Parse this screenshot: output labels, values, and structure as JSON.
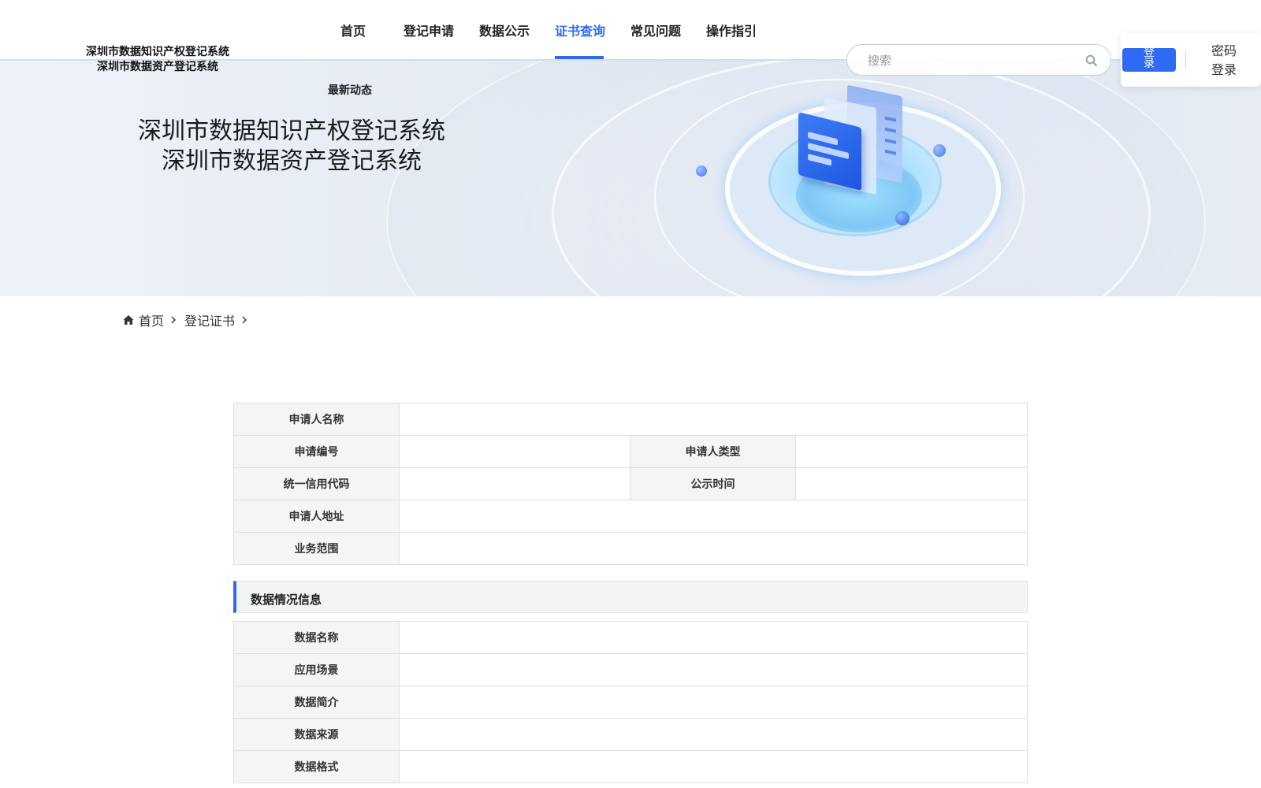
{
  "app": {
    "logo_line1": "深圳市数据知识产权登记系统",
    "logo_line2": "深圳市数据资产登记系统"
  },
  "nav": {
    "items": [
      {
        "label": "首页",
        "active": false
      },
      {
        "label": "登记申请",
        "active": false
      },
      {
        "label": "数据公示",
        "active": false
      },
      {
        "label": "证书查询",
        "active": true
      },
      {
        "label": "常见问题",
        "active": false
      },
      {
        "label": "操作指引",
        "active": false
      }
    ],
    "sub_item": "最新动态"
  },
  "search": {
    "placeholder": "搜索",
    "value": "",
    "icon": "search-icon"
  },
  "auth": {
    "login_label_top": "登",
    "login_label_bottom": "录",
    "password_login_line1": "密码",
    "password_login_line2": "登录"
  },
  "hero": {
    "title_line1": "深圳市数据知识产权登记系统",
    "title_line2": "深圳市数据资产登记系统"
  },
  "breadcrumb": {
    "home_icon": "home-icon",
    "home": "首页",
    "current": "登记证书"
  },
  "applicant": {
    "name_label": "申请人名称",
    "name_value": "",
    "number_label": "申请编号",
    "number_value": "",
    "type_label": "申请人类型",
    "type_value": "",
    "credit_code_label": "统一信用代码",
    "credit_code_value": "",
    "publish_time_label": "公示时间",
    "publish_time_value": "",
    "address_label": "申请人地址",
    "address_value": "",
    "scope_label": "业务范围",
    "scope_value": ""
  },
  "data_info": {
    "section_title": "数据情况信息",
    "name_label": "数据名称",
    "name_value": "",
    "scenario_label": "应用场景",
    "scenario_value": "",
    "summary_label": "数据简介",
    "summary_value": "",
    "source_label": "数据来源",
    "source_value": "",
    "format_label": "数据格式",
    "format_value": ""
  },
  "colors": {
    "accent": "#2f6bf2",
    "label_bg": "#f5f5f5",
    "border": "#dcdfe6"
  }
}
